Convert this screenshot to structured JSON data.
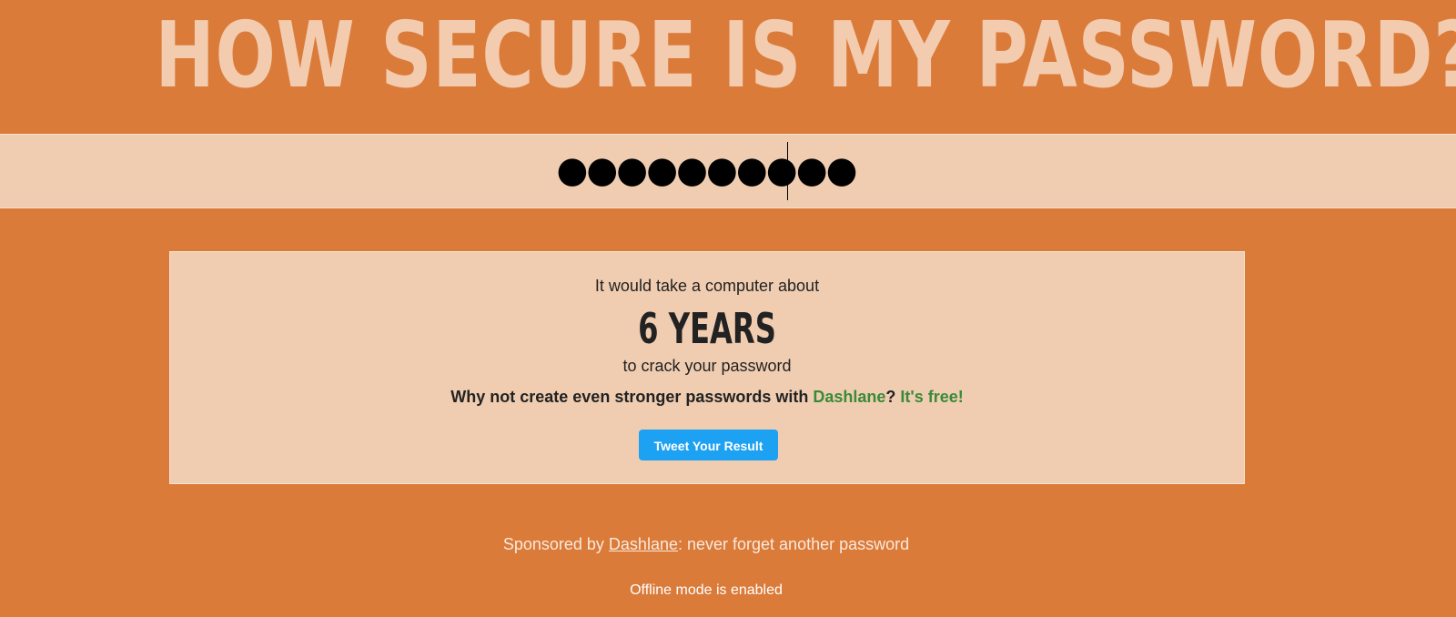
{
  "header": {
    "title": "HOW SECURE IS MY PASSWORD?"
  },
  "password_field": {
    "value": "●●●●●●●●●●"
  },
  "result": {
    "intro": "It would take a computer about",
    "time": "6 YEARS",
    "outro": "to crack your password",
    "promo_text": "Why not create even stronger passwords with ",
    "promo_link": "Dashlane",
    "promo_question": "?",
    "promo_free": "It's free!",
    "tweet_button": "Tweet Your Result"
  },
  "footer": {
    "sponsor_prefix": "Sponsored by ",
    "sponsor_link": "Dashlane",
    "sponsor_suffix": ": never forget another password",
    "offline_notice": "Offline mode is enabled"
  },
  "colors": {
    "background": "#DA7B3A",
    "panel": "#F0CDB1",
    "title": "#F3CBAE",
    "link_green": "#3A8A3A",
    "tweet_blue": "#1DA1F2"
  }
}
